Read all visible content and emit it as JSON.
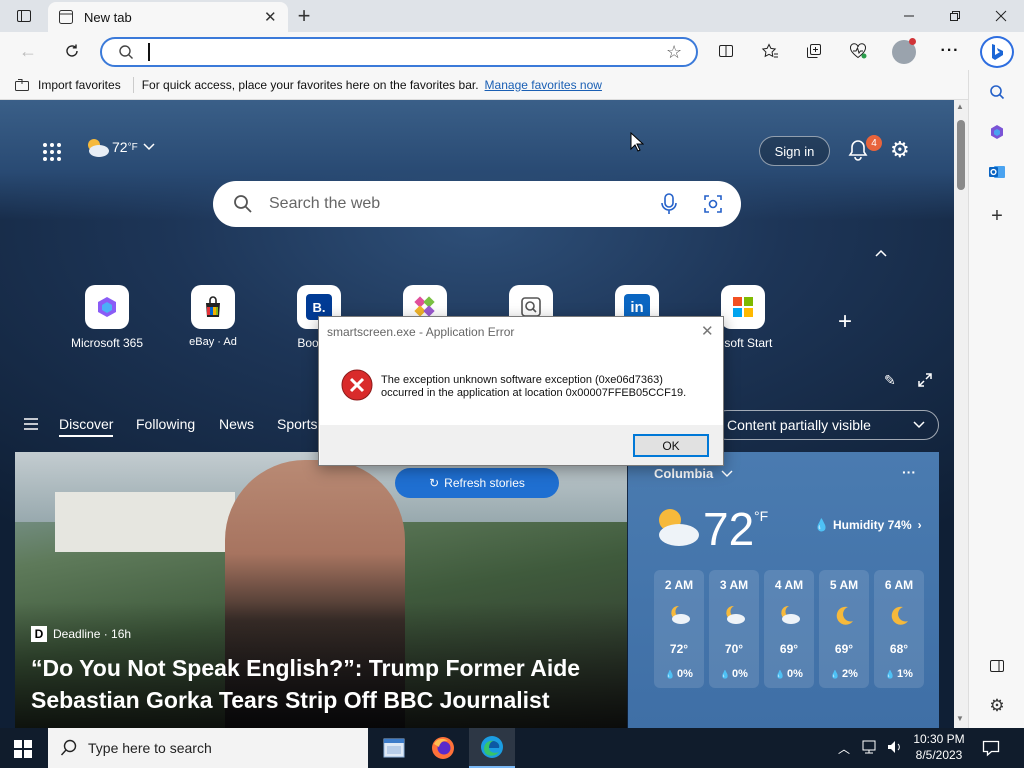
{
  "browser": {
    "tab_title": "New tab",
    "address_value": "",
    "favorites_bar": {
      "import_label": "Import favorites",
      "message": "For quick access, place your favorites here on the favorites bar.",
      "manage_link": "Manage favorites now"
    }
  },
  "ntp": {
    "temperature": "72",
    "temp_unit": "°F",
    "sign_in": "Sign in",
    "notification_count": "4",
    "search_placeholder": "Search the web",
    "quick_links": [
      {
        "label": "Microsoft 365",
        "glyph": "◇"
      },
      {
        "label": "eBay · Ad",
        "glyph": "🛍"
      },
      {
        "label": "Booking",
        "glyph": "B."
      },
      {
        "label": "",
        "glyph": "◆"
      },
      {
        "label": "",
        "glyph": "Q"
      },
      {
        "label": "",
        "glyph": "in"
      },
      {
        "label": "rosoft Start",
        "glyph": "⊞"
      }
    ],
    "nav": [
      "Discover",
      "Following",
      "News",
      "Sports"
    ],
    "content_dropdown": "Content partially visible",
    "refresh_label": "Refresh stories",
    "article": {
      "source": "Deadline · 16h",
      "headline_line1": "“Do You Not Speak English?”: Trump Former Aide",
      "headline_line2": "Sebastian Gorka Tears Strip Off BBC Journalist"
    },
    "weather": {
      "city": "Columbia",
      "temp": "72",
      "unit": "°F",
      "humidity": "Humidity 74%",
      "hours": [
        {
          "time": "2 AM",
          "temp": "72°",
          "precip": "0%",
          "icon": "partly-cloudy-night"
        },
        {
          "time": "3 AM",
          "temp": "70°",
          "precip": "0%",
          "icon": "partly-cloudy-night"
        },
        {
          "time": "4 AM",
          "temp": "69°",
          "precip": "0%",
          "icon": "partly-cloudy-night"
        },
        {
          "time": "5 AM",
          "temp": "69°",
          "precip": "2%",
          "icon": "moon"
        },
        {
          "time": "6 AM",
          "temp": "68°",
          "precip": "1%",
          "icon": "moon"
        }
      ]
    }
  },
  "dialog": {
    "title": "smartscreen.exe - Application Error",
    "message_line1": "The exception unknown software exception (0xe06d7363)",
    "message_line2": "occurred in the application at location 0x00007FFEB05CCF19.",
    "ok_label": "OK"
  },
  "taskbar": {
    "search_placeholder": "Type here to search",
    "time": "10:30 PM",
    "date": "8/5/2023"
  },
  "colors": {
    "accent": "#0078d7",
    "link": "#1a5fb4",
    "refresh_button": "#1f6fd1",
    "error_red": "#d92b2b"
  }
}
